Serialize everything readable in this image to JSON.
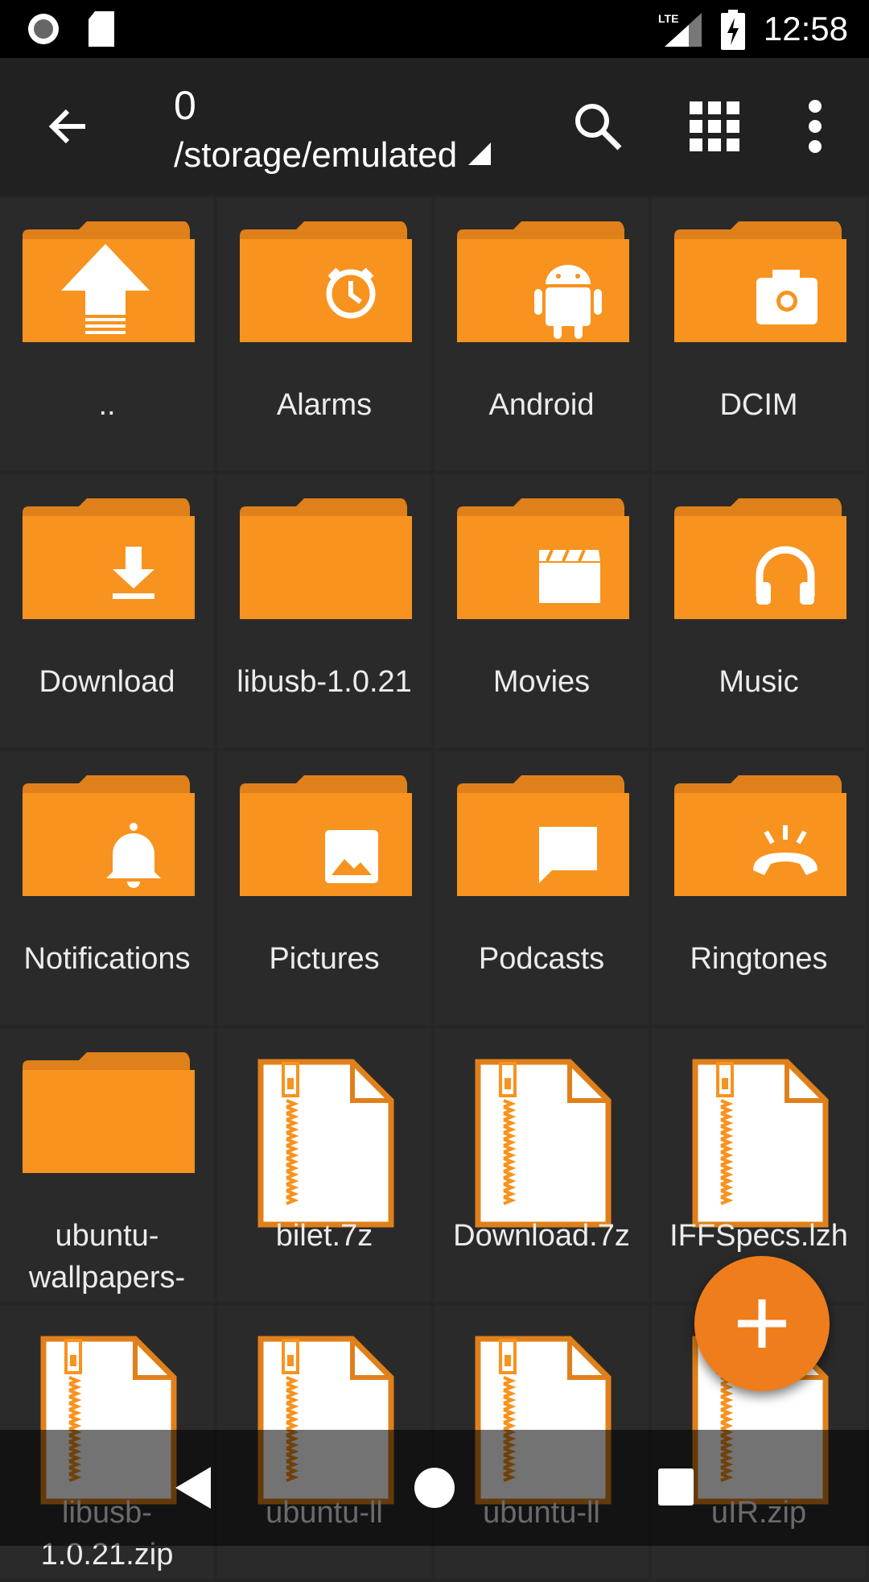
{
  "status_bar": {
    "time": "12:58",
    "network": "LTE",
    "icons": [
      "record-icon",
      "sd-card-icon",
      "signal-icon",
      "battery-charging-icon"
    ]
  },
  "toolbar": {
    "title": "0",
    "path": "/storage/emulated",
    "icons": [
      "back-arrow-icon",
      "search-icon",
      "grid-view-icon",
      "more-vert-icon"
    ]
  },
  "colors": {
    "accent": "#F7931E",
    "fab": "#EF7D1C",
    "background": "#2A2A2A"
  },
  "grid": {
    "items": [
      {
        "label": "..",
        "type": "folder",
        "glyph": "up-arrow"
      },
      {
        "label": "Alarms",
        "type": "folder",
        "glyph": "alarm"
      },
      {
        "label": "Android",
        "type": "folder",
        "glyph": "android"
      },
      {
        "label": "DCIM",
        "type": "folder",
        "glyph": "camera"
      },
      {
        "label": "Download",
        "type": "folder",
        "glyph": "download"
      },
      {
        "label": "libusb-1.0.21",
        "type": "folder",
        "glyph": ""
      },
      {
        "label": "Movies",
        "type": "folder",
        "glyph": "movie"
      },
      {
        "label": "Music",
        "type": "folder",
        "glyph": "headphones"
      },
      {
        "label": "Notifications",
        "type": "folder",
        "glyph": "bell"
      },
      {
        "label": "Pictures",
        "type": "folder",
        "glyph": "image"
      },
      {
        "label": "Podcasts",
        "type": "folder",
        "glyph": "message"
      },
      {
        "label": "Ringtones",
        "type": "folder",
        "glyph": "ringtone"
      },
      {
        "label": "ubuntu-wallpapers-",
        "type": "folder",
        "glyph": ""
      },
      {
        "label": "bilet.7z",
        "type": "archive",
        "glyph": "zip"
      },
      {
        "label": "Download.7z",
        "type": "archive",
        "glyph": "zip"
      },
      {
        "label": "IFFSpecs.lzh",
        "type": "archive",
        "glyph": "zip"
      },
      {
        "label": "libusb-1.0.21.zip",
        "type": "archive",
        "glyph": "zip"
      },
      {
        "label": "ubuntu-ll",
        "type": "archive",
        "glyph": "zip"
      },
      {
        "label": "ubuntu-ll",
        "type": "archive",
        "glyph": "zip"
      },
      {
        "label": "uIR.zip",
        "type": "archive",
        "glyph": "zip"
      }
    ]
  },
  "fab": {
    "icon": "plus-icon"
  },
  "nav_bar": {
    "icons": [
      "back-icon",
      "home-icon",
      "recents-icon"
    ]
  }
}
